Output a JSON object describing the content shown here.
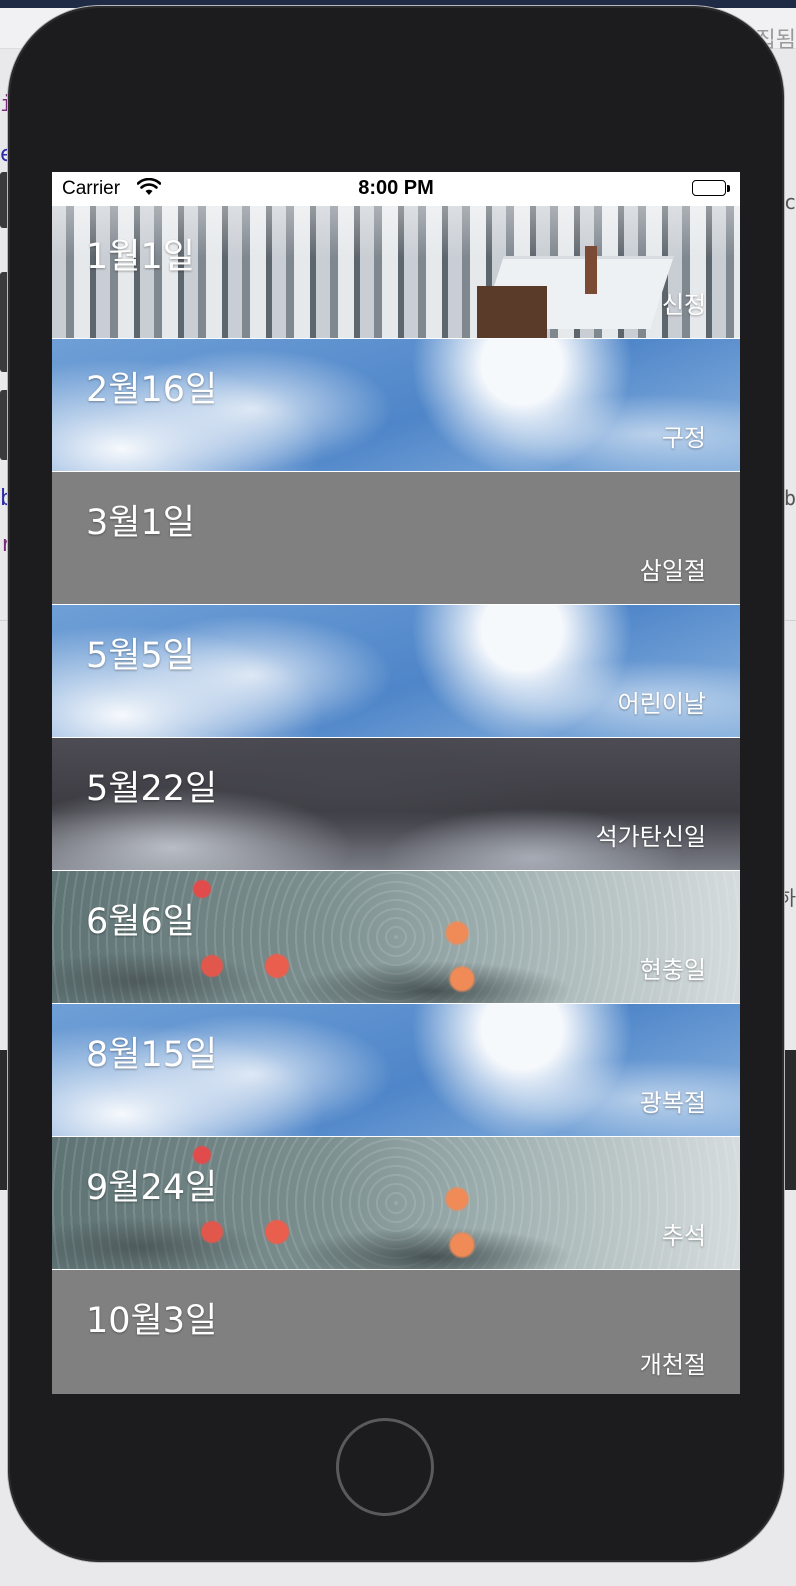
{
  "status_bar": {
    "carrier": "Carrier",
    "time": "8:00 PM"
  },
  "holidays": [
    {
      "date": "1월1일",
      "name": "신정",
      "background": "snow"
    },
    {
      "date": "2월16일",
      "name": "구정",
      "background": "sky"
    },
    {
      "date": "3월1일",
      "name": "삼일절",
      "background": "gray"
    },
    {
      "date": "5월5일",
      "name": "어린이날",
      "background": "sky"
    },
    {
      "date": "5월22일",
      "name": "석가탄신일",
      "background": "storm"
    },
    {
      "date": "6월6일",
      "name": "현충일",
      "background": "rain"
    },
    {
      "date": "8월15일",
      "name": "광복절",
      "background": "sky"
    },
    {
      "date": "9월24일",
      "name": "추석",
      "background": "rain"
    },
    {
      "date": "10월3일",
      "name": "개천절",
      "background": "gray"
    }
  ],
  "colors": {
    "phone_body": "#1c1c1e",
    "row_gray": "#808080",
    "text": "#ffffff"
  }
}
